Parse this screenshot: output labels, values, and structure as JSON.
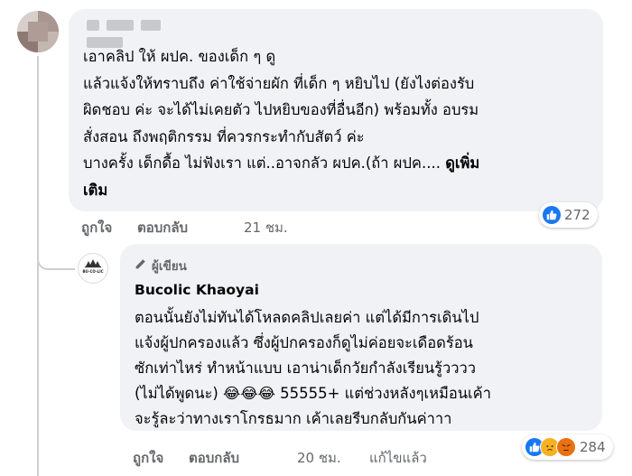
{
  "comment": {
    "text_lines": [
      "เอาคลิป ให้ ผปค. ของเด็ก ๆ ดู",
      "แล้วแจ้งให้ทราบถึง ค่าใช้จ่ายผัก ที่เด็ก ๆ หยิบไป (ยังไงต่องรับ",
      "ผิดชอบ ค่ะ จะได้ไม่เคยตัว ไปหยิบของที่อื่นอีก) พร้อมทั้ง อบรม",
      "สั่งสอน ถึงพฤติกรรม ที่ควรกระทำกับสัตว์ ค่ะ",
      "บางครั้ง เด็กดื้อ ไม่ฟังเรา แต่..อาจกลัว ผปค.(ถ้า ผปค.... "
    ],
    "see_more_1": "ดูเพิ่ม",
    "see_more_2": "เติม",
    "like_label": "ถูกใจ",
    "reply_label": "ตอบกลับ",
    "time": "21 ชม.",
    "reaction_count": "272"
  },
  "reply": {
    "author_badge": "ผู้เขียน",
    "author_name": "Bucolic Khaoyai",
    "avatar_text": "BU-CO-LIC",
    "text_lines": [
      "ตอนนั้นยังไม่ทันได้โหลดคลิปเลยค่า แต่ได้มีการเดินไป",
      "แจ้งผู้ปกครองแล้ว ซึ่งผู้ปกครองก็ดูไม่ค่อยจะเดือดร้อน",
      "ซักเท่าไหร่ ทำหน้าแบบ เอาน่าเด็กวัยกำลังเรียนรู้วววว",
      "(ไม่ได้พูดนะ) 😂😂😂 55555+ แต่ช่วงหลังๆเหมือนเค้า",
      "จะรู้ละว่าทางเราโกรธมาก เค้าเลยรีบกลับกันค่าาา"
    ],
    "like_label": "ถูกใจ",
    "reply_label": "ตอบกลับ",
    "time": "20 ชม.",
    "edited_label": "แก้ไขแล้ว",
    "reaction_count": "284"
  },
  "colors": {
    "bubble": "#f0f2f5",
    "secondary_text": "#65676b",
    "like_blue": "#1877f2"
  },
  "icons": [
    "like-icon",
    "sad-icon",
    "angry-icon",
    "pencil-icon"
  ]
}
